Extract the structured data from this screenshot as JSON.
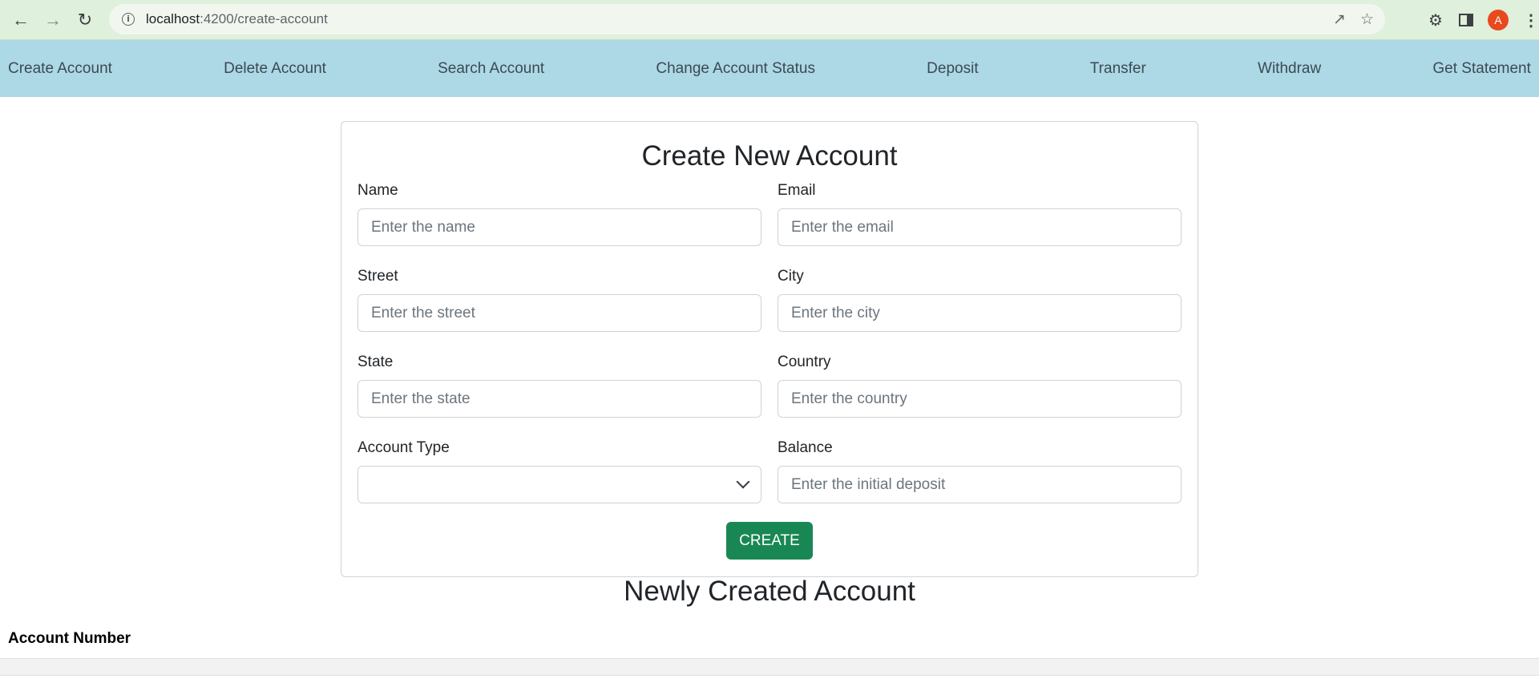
{
  "browser": {
    "url_host": "localhost",
    "url_path": ":4200/create-account",
    "avatar_letter": "A"
  },
  "nav": {
    "items": [
      {
        "label": "Create Account"
      },
      {
        "label": "Delete Account"
      },
      {
        "label": "Search Account"
      },
      {
        "label": "Change Account Status"
      },
      {
        "label": "Deposit"
      },
      {
        "label": "Transfer"
      },
      {
        "label": "Withdraw"
      },
      {
        "label": "Get Statement"
      }
    ],
    "background": "#add8e6"
  },
  "form": {
    "title": "Create New Account",
    "name": {
      "label": "Name",
      "placeholder": "Enter the name",
      "value": ""
    },
    "email": {
      "label": "Email",
      "placeholder": "Enter the email",
      "value": ""
    },
    "street": {
      "label": "Street",
      "placeholder": "Enter the street",
      "value": ""
    },
    "city": {
      "label": "City",
      "placeholder": "Enter the city",
      "value": ""
    },
    "state": {
      "label": "State",
      "placeholder": "Enter the state",
      "value": ""
    },
    "country": {
      "label": "Country",
      "placeholder": "Enter the country",
      "value": ""
    },
    "account_type": {
      "label": "Account Type",
      "selected": ""
    },
    "balance": {
      "label": "Balance",
      "placeholder": "Enter the initial deposit",
      "value": ""
    },
    "submit_label": "CREATE",
    "submit_color": "#198754"
  },
  "result": {
    "title": "Newly Created Account",
    "account_number_label": "Account Number"
  }
}
